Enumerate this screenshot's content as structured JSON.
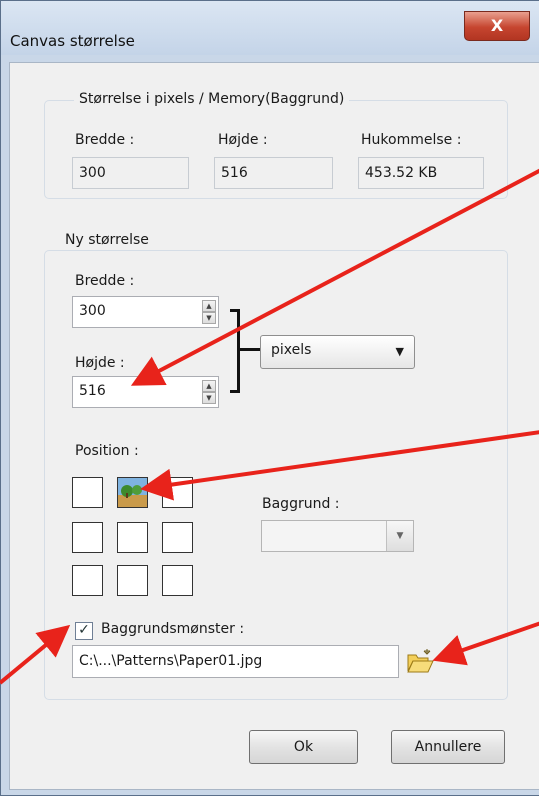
{
  "window": {
    "title": "Canvas størrelse",
    "close_label": "X"
  },
  "current": {
    "group_title": "Størrelse i pixels / Memory(Baggrund)",
    "width_label": "Bredde :",
    "width_value": "300",
    "height_label": "Højde :",
    "height_value": "516",
    "memory_label": "Hukommelse :",
    "memory_value": "453.52 KB"
  },
  "new_size": {
    "group_title": "Ny størrelse",
    "width_label": "Bredde :",
    "width_value": "300",
    "height_label": "Højde :",
    "height_value": "516",
    "unit_selected": "pixels",
    "position_label": "Position :",
    "background_label": "Baggrund :",
    "background_value": "",
    "pattern_checked": true,
    "pattern_label": "Baggrundsmønster :",
    "pattern_path": "C:\\...\\Patterns\\Paper01.jpg"
  },
  "buttons": {
    "ok": "Ok",
    "cancel": "Annullere"
  },
  "colors": {
    "annotation_arrow": "#e8231b",
    "close_button": "#c6452f"
  },
  "icons": {
    "close": "close-icon",
    "folder": "folder-open-icon",
    "position": "landscape-image-icon"
  }
}
